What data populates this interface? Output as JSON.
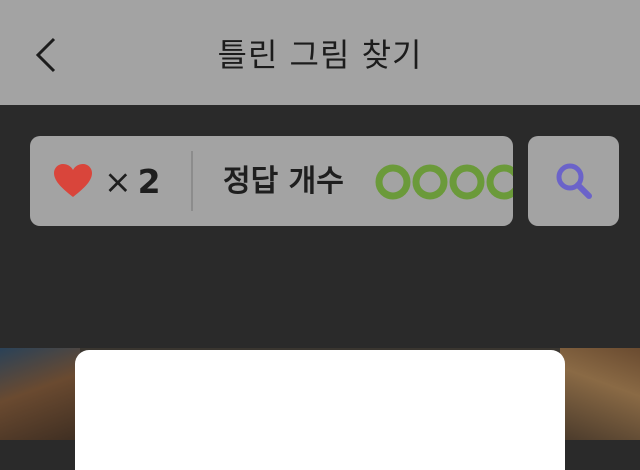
{
  "header": {
    "title": "틀린 그림 찾기"
  },
  "status": {
    "lives_text": "× 2",
    "lives_times": "×",
    "lives_count": "2",
    "answer_label": "정답 개수",
    "answers_found": 0,
    "answers_total": 5
  },
  "colors": {
    "header_bg": "#a3a3a3",
    "dark_bg": "#2a2a2a",
    "heart": "#d9453b",
    "ring": "#6b9a3a",
    "search_icon": "#6b63c9"
  },
  "icons": {
    "back": "chevron-left-icon",
    "heart": "heart-icon",
    "search": "magnifier-icon"
  }
}
